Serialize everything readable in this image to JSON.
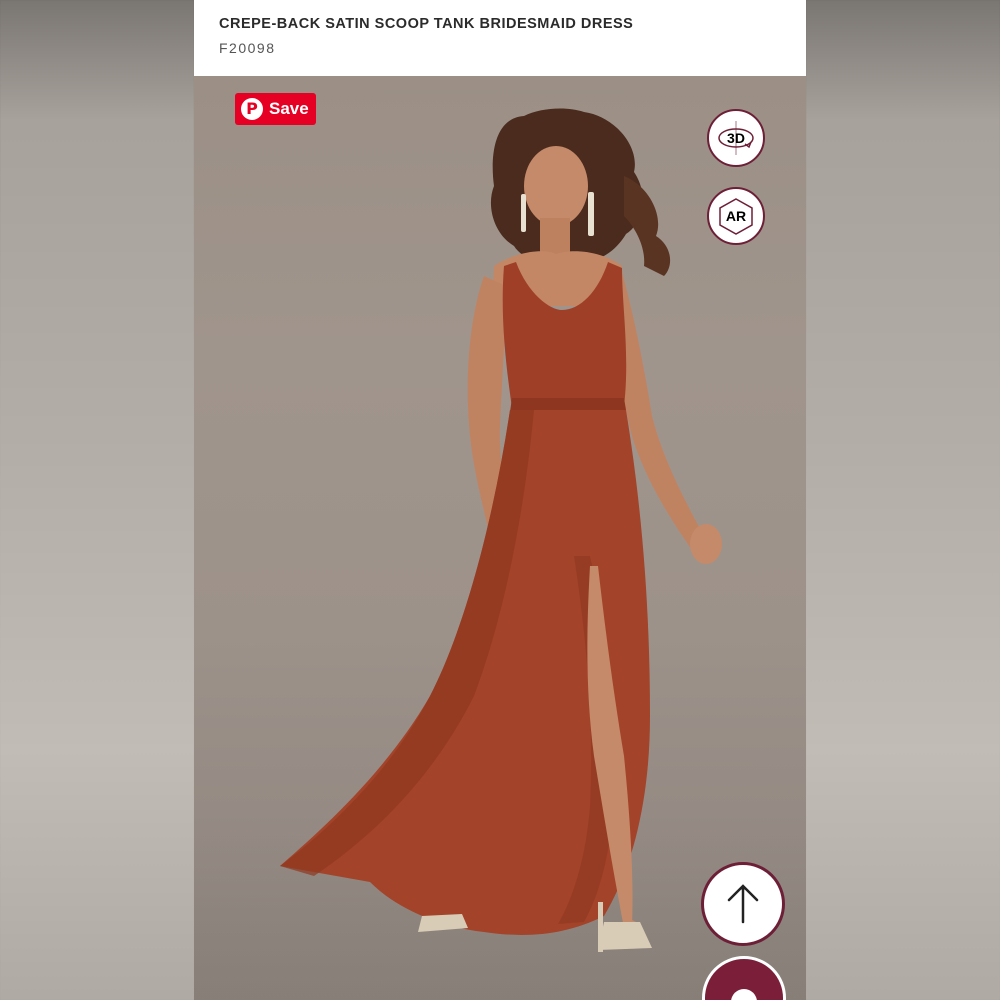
{
  "product": {
    "title": "CREPE-BACK SATIN SCOOP TANK BRIDESMAID DRESS",
    "sku": "F20098"
  },
  "pinterest": {
    "label": "Save",
    "icon": "pinterest-icon",
    "color": "#e60023"
  },
  "controls": {
    "view_3d_label": "3D",
    "view_ar_label": "AR",
    "back_to_top_icon": "arrow-up-icon",
    "chat_icon": "chat-icon",
    "accent": "#6d1f37"
  }
}
